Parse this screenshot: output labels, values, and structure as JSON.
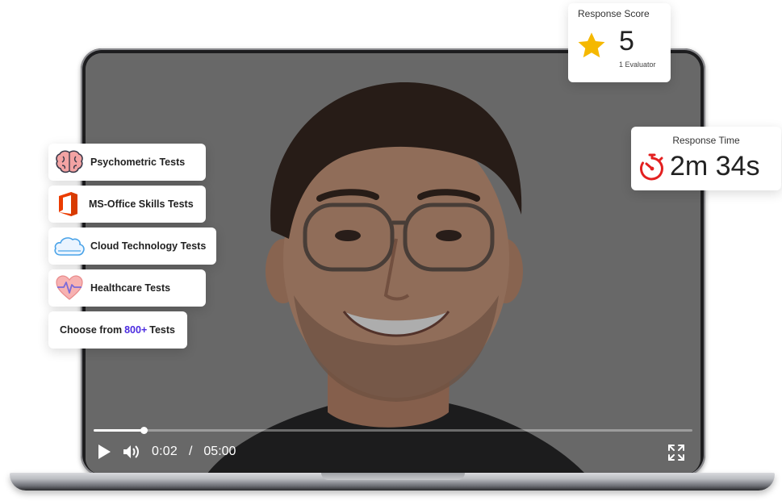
{
  "video": {
    "current_time": "0:02",
    "separator": "/",
    "duration": "05:00",
    "progress_fraction": 0.083
  },
  "score_card": {
    "title": "Response Score",
    "value": "5",
    "evaluators": "1 Evaluator",
    "star_color": "#f5b800"
  },
  "time_card": {
    "title": "Response Time",
    "value": "2m 34s",
    "icon_color": "#e32020"
  },
  "tests": [
    {
      "label": "Psychometric Tests",
      "icon": "brain-icon"
    },
    {
      "label": "MS-Office Skills Tests",
      "icon": "office-icon"
    },
    {
      "label": "Cloud Technology Tests",
      "icon": "cloud-icon"
    },
    {
      "label": "Healthcare Tests",
      "icon": "heart-pulse-icon"
    }
  ],
  "choose": {
    "prefix": "Choose from",
    "count": "800+",
    "suffix": "Tests",
    "accent_color": "#4b2be0"
  }
}
